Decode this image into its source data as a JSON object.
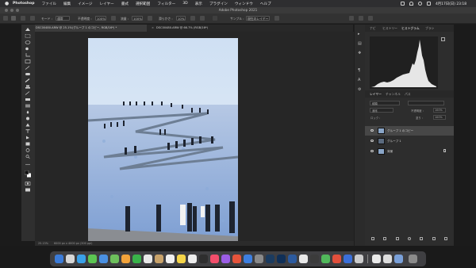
{
  "menubar": {
    "app": "Photoshop",
    "items": [
      "ファイル",
      "編集",
      "イメージ",
      "レイヤー",
      "書式",
      "選択範囲",
      "フィルター",
      "3D",
      "表示",
      "プラグイン",
      "ウィンドウ",
      "ヘルプ"
    ],
    "clock": "4月17日(日) 23:18"
  },
  "titlebar": {
    "title": "Adobe Photoshop 2021"
  },
  "options": {
    "mode_label": "モード :",
    "mode_value": "通常",
    "opacity_label": "不透明度 :",
    "opacity_value": "100%",
    "flow_label": "流量 :",
    "flow_value": "100%",
    "smoothing_label": "滑らかさ :",
    "smoothing_value": "10%",
    "sample_label": "サンプル :",
    "sample_value": "現在のレイヤー"
  },
  "tabs": [
    {
      "label": "DSC00480.ARW @ 25.1%(グループ 1 のコピー, RGB/16*) *",
      "active": true
    },
    {
      "label": "DSC00480.ARW @ 66.7% (RGB/16*)",
      "active": false
    }
  ],
  "status": {
    "zoom": "25.13%",
    "info": "6000 px x 4000 px (300 ppi)"
  },
  "panel": {
    "tabs": [
      "ナビ",
      "ヒストリー",
      "ヒストグラム",
      "ブラシ"
    ],
    "active_tab": "ヒストグラム",
    "layers_tabs": [
      "レイヤー",
      "チャンネル",
      "パス"
    ],
    "layers_active": "レイヤー",
    "kind": "種類",
    "blend": "通常",
    "opacity_label": "不透明度 :",
    "opacity": "100%",
    "lock_label": "ロック :",
    "fill_label": "塗り :",
    "fill": "100%",
    "layers": [
      {
        "name": "グループ 1 のコピー",
        "selected": true
      },
      {
        "name": "グループ 1",
        "selected": false
      },
      {
        "name": "背景",
        "selected": false
      }
    ]
  },
  "colors": {
    "accent": "#2d8ceb",
    "panel": "#2d2d2d",
    "sky": "#dfe9f5",
    "flowers": "#9bb8e0"
  },
  "icons": [
    "apple-icon",
    "wifi-icon",
    "search-icon",
    "move-tool-icon",
    "marquee-tool-icon",
    "lasso-tool-icon",
    "brush-tool-icon",
    "eye-icon",
    "lock-icon"
  ]
}
